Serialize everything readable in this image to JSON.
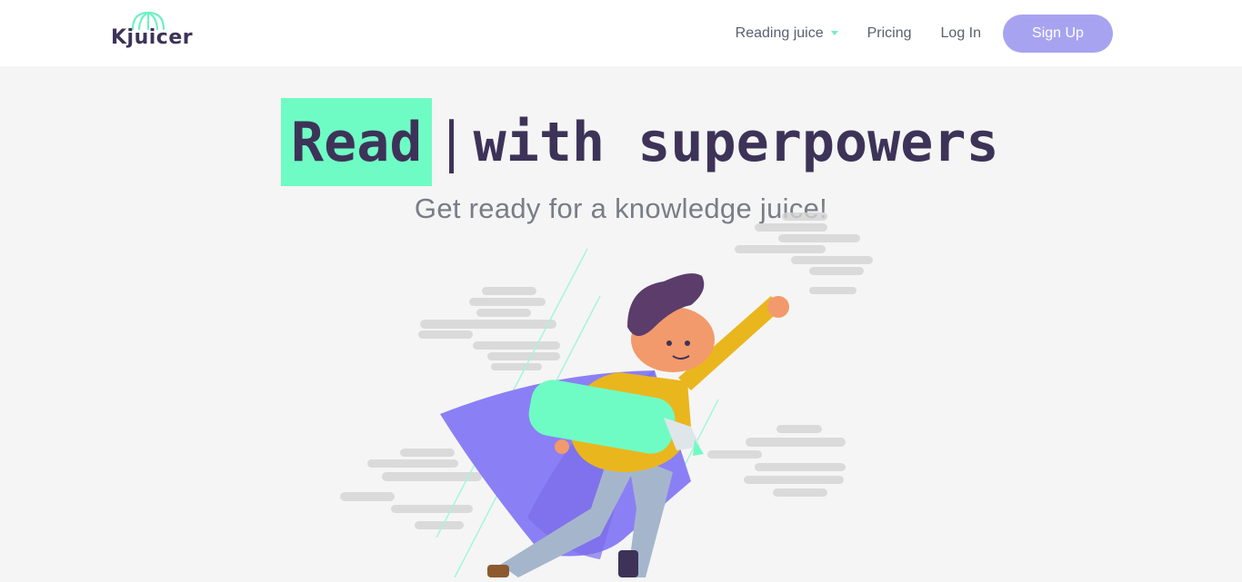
{
  "header": {
    "brand": "Kjuicer",
    "nav": [
      {
        "label": "Reading juice",
        "has_dropdown": true
      },
      {
        "label": "Pricing"
      },
      {
        "label": "Log In"
      }
    ],
    "signup_label": "Sign Up"
  },
  "hero": {
    "title_highlight": "Read",
    "title_cursor": "|",
    "title_rest": "with superpowers",
    "subtitle": "Get ready for a knowledge juice!"
  },
  "colors": {
    "accent_green": "#6ffcc4",
    "accent_purple": "#a8a3f0",
    "text_dark": "#3d3358",
    "background": "#f5f5f5"
  }
}
